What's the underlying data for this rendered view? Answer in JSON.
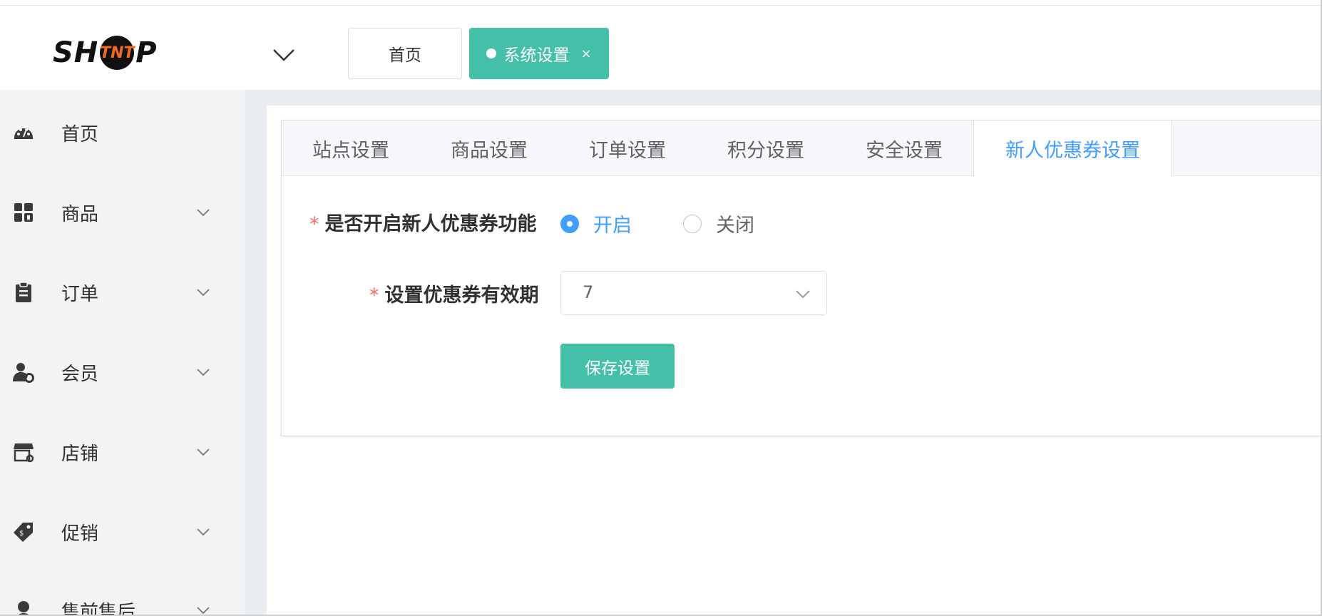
{
  "logo": {
    "prefix": "SH",
    "middle": "TNT",
    "suffix": "P"
  },
  "header": {
    "collapse_icon": "chevron-down-icon",
    "tags": [
      {
        "label": "首页"
      },
      {
        "label": "系统设置",
        "close": "×"
      }
    ]
  },
  "sidebar": {
    "items": [
      {
        "label": "首页",
        "icon": "dashboard-icon"
      },
      {
        "label": "商品",
        "icon": "goods-icon"
      },
      {
        "label": "订单",
        "icon": "clipboard-icon"
      },
      {
        "label": "会员",
        "icon": "member-icon"
      },
      {
        "label": "店铺",
        "icon": "store-icon"
      },
      {
        "label": "促销",
        "icon": "tag-icon"
      },
      {
        "label": "售前售后",
        "icon": "support-icon"
      }
    ]
  },
  "tabs": [
    "站点设置",
    "商品设置",
    "订单设置",
    "积分设置",
    "安全设置",
    "新人优惠券设置"
  ],
  "form": {
    "enable_label": "是否开启新人优惠券功能",
    "enable_on": "开启",
    "enable_off": "关闭",
    "enable_selected": "开启",
    "validity_label": "设置优惠券有效期",
    "validity_value": "7",
    "required_mark": "*",
    "save_label": "保存设置"
  },
  "colors": {
    "accent": "#45c0a8",
    "primary": "#409eff",
    "required": "#f56c6c"
  }
}
